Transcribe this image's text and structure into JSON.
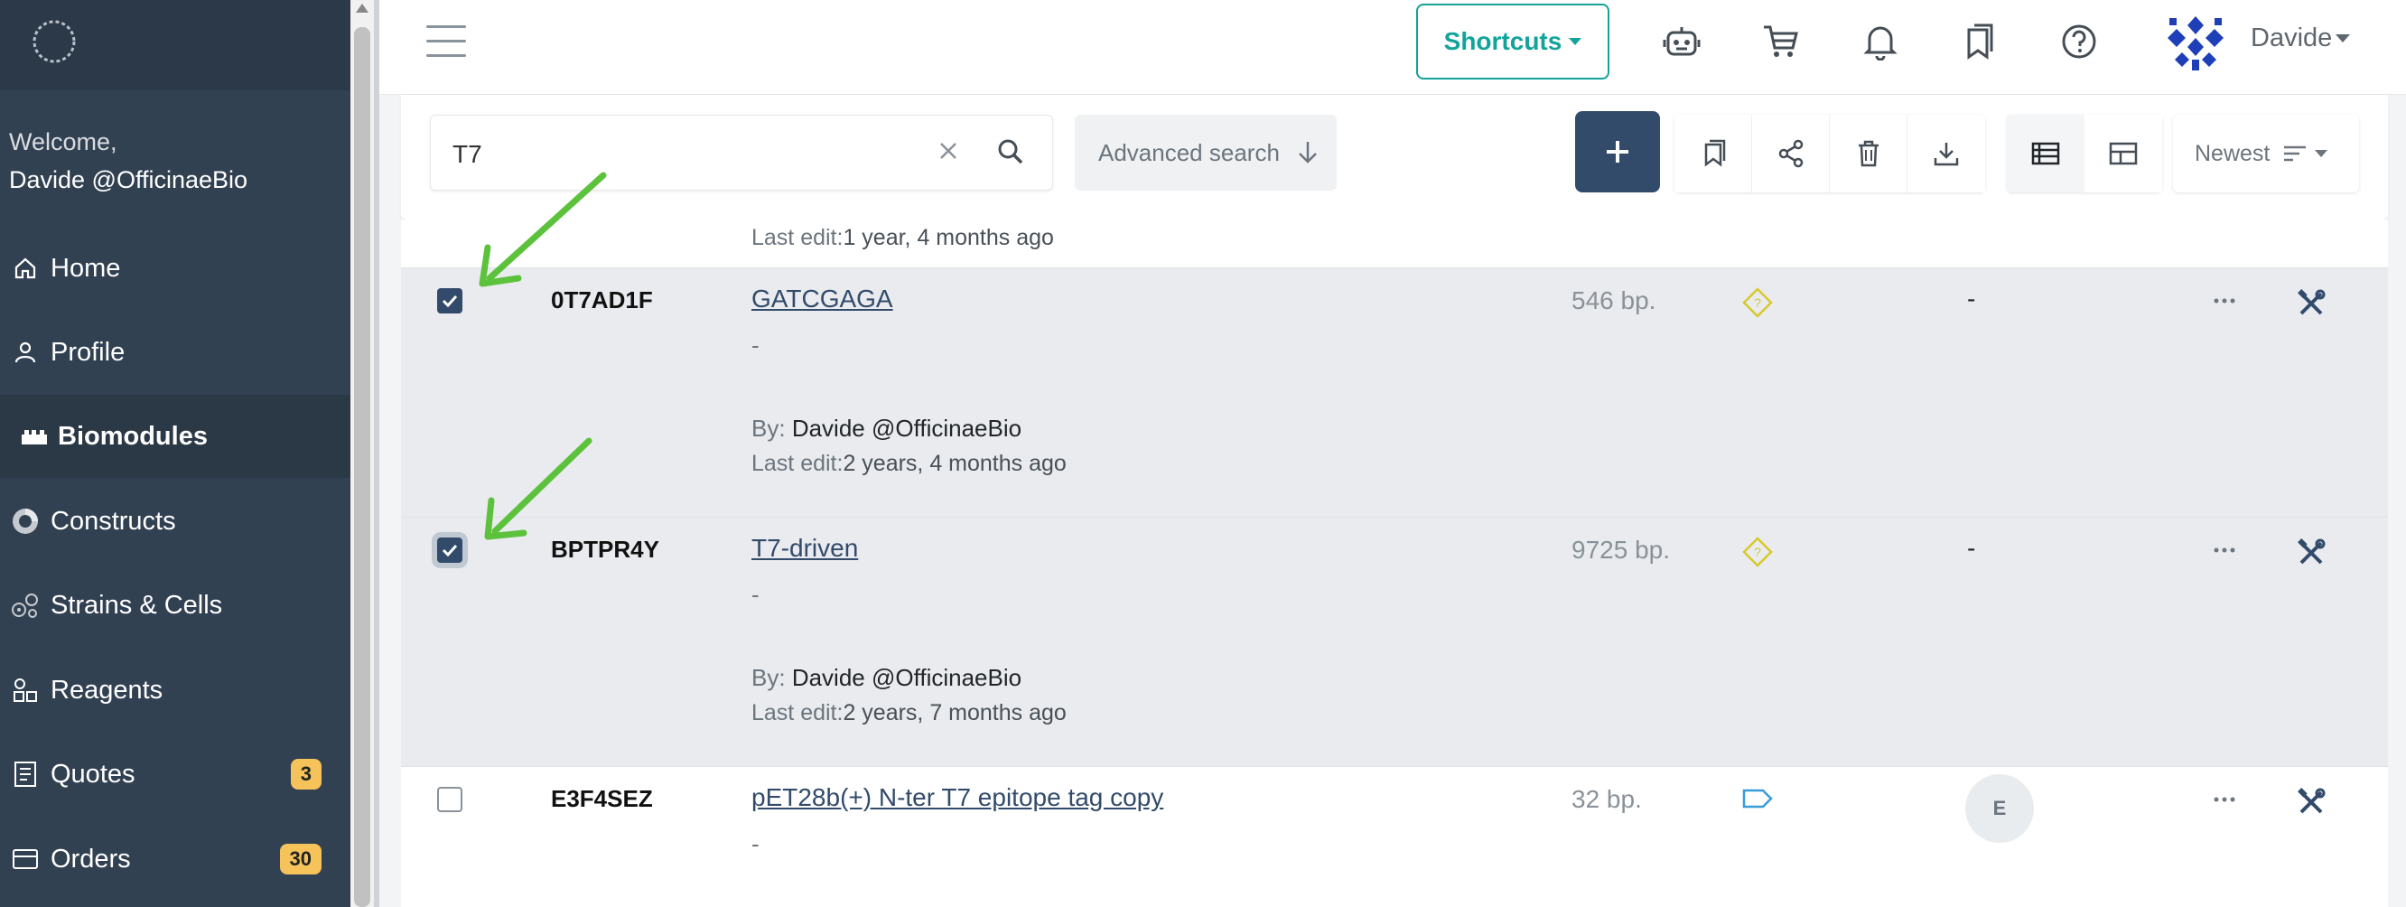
{
  "sidebar": {
    "welcome_line1": "Welcome,",
    "welcome_line2": "Davide @OfficinaeBio",
    "items": [
      {
        "label": "Home",
        "icon": "home-icon"
      },
      {
        "label": "Profile",
        "icon": "user-icon"
      },
      {
        "label": "Biomodules",
        "icon": "biomodules-icon",
        "active": true
      },
      {
        "label": "Constructs",
        "icon": "plasmid-icon"
      },
      {
        "label": "Strains & Cells",
        "icon": "cells-icon"
      },
      {
        "label": "Reagents",
        "icon": "reagents-icon"
      },
      {
        "label": "Quotes",
        "icon": "quotes-icon",
        "badge": "3"
      },
      {
        "label": "Orders",
        "icon": "orders-icon",
        "badge": "30"
      }
    ]
  },
  "header": {
    "shortcuts_label": "Shortcuts",
    "user_name": "Davide",
    "icons": [
      "robot-icon",
      "cart-icon",
      "bell-icon",
      "bookmarks-icon",
      "help-icon"
    ]
  },
  "toolbar": {
    "search_value": "T7",
    "advanced_search_label": "Advanced search",
    "sort_label": "Newest"
  },
  "list": {
    "previous_last_edit_label": "Last edit:",
    "previous_last_edit_value": "1 year, 4 months ago",
    "rows": [
      {
        "id": "0T7AD1F",
        "name": "GATCGAGA",
        "description": "-",
        "by_label": "By:",
        "by_value": "Davide @OfficinaeBio",
        "last_edit_label": "Last edit:",
        "last_edit_value": "2 years, 4 months ago",
        "size": "546 bp.",
        "type_icon": "unknown-diamond-icon",
        "owner": "-",
        "checked": true
      },
      {
        "id": "BPTPR4Y",
        "name": "T7-driven",
        "description": "-",
        "by_label": "By:",
        "by_value": "Davide @OfficinaeBio",
        "last_edit_label": "Last edit:",
        "last_edit_value": "2 years, 7 months ago",
        "size": "9725 bp.",
        "type_icon": "unknown-diamond-icon",
        "owner": "-",
        "checked": true
      },
      {
        "id": "E3F4SEZ",
        "name": "pET28b(+) N-ter T7 epitope tag copy",
        "description": "-",
        "size": "32 bp.",
        "type_icon": "tag-icon",
        "owner_initial": "E",
        "checked": false
      }
    ]
  },
  "colors": {
    "sidebar_bg": "#324152",
    "accent_teal": "#12a39a",
    "primary_navy": "#324b6b",
    "badge_yellow": "#f5c35a",
    "annotation_arrow": "#5cc23c"
  }
}
